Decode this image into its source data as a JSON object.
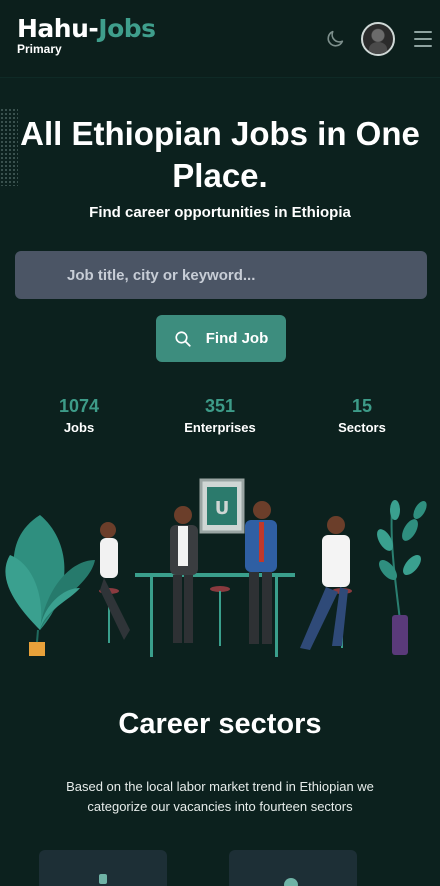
{
  "header": {
    "logo_part1": "Hahu-",
    "logo_part2": "Jobs",
    "logo_sub": "Primary",
    "icons": [
      "moon-icon",
      "avatar",
      "hamburger-menu-icon"
    ]
  },
  "hero": {
    "title": "All Ethiopian Jobs in One Place.",
    "subtitle": "Find career opportunities in Ethiopia",
    "search_placeholder": "Job title, city or keyword...",
    "search_value": "",
    "find_button": "Find Job"
  },
  "stats": [
    {
      "value": "1074",
      "label": "Jobs"
    },
    {
      "value": "351",
      "label": "Enterprises"
    },
    {
      "value": "15",
      "label": "Sectors"
    }
  ],
  "sectors": {
    "title": "Career sectors",
    "description": "Based on the local labor market trend in Ethiopian we categorize our vacancies into fourteen sectors"
  },
  "colors": {
    "background": "#0c211e",
    "accent": "#3d8d7e",
    "stat_number": "#3d9b88",
    "search_bg": "#4b5565",
    "card_bg": "#1d2f36"
  }
}
